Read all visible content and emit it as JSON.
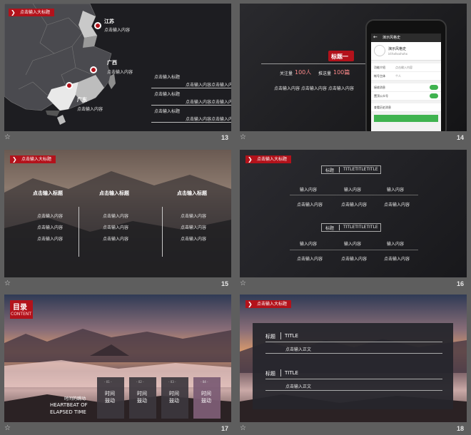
{
  "slides": [
    {
      "number": "13",
      "tag": "点击输入大标题",
      "regions": [
        {
          "name": "江苏",
          "text": "点击输入内容"
        },
        {
          "name": "广西",
          "text": "点击输入内容"
        },
        {
          "name": "广东",
          "text": "点击输入内容"
        }
      ],
      "list": [
        {
          "title": "点击输入标题",
          "text": "点击输入内容点击输入内容"
        },
        {
          "title": "点击输入标题",
          "text": "点击输入内容点击输入内容"
        },
        {
          "title": "点击输入标题",
          "text": "点击输入内容点击输入内容"
        }
      ]
    },
    {
      "number": "14",
      "badge": "标题一",
      "stat1_label": "关注量",
      "stat1_value": "100人",
      "stat2_label": "推送量",
      "stat2_value": "100篇",
      "caption": "点击输入内容 点击输入内容 点击输入内容",
      "phone": {
        "header": "演示风格史",
        "profile_name": "演示风格史",
        "profile_sub": "id:hxhxxhxhx",
        "rows": [
          {
            "label": "功能介绍",
            "value": "点击输入内容"
          },
          {
            "label": "帐号主体",
            "value": "个人"
          },
          {
            "label": "接收消息",
            "value": ""
          },
          {
            "label": "置顶公众号",
            "value": ""
          },
          {
            "label": "查看历史消息",
            "value": ""
          }
        ]
      }
    },
    {
      "number": "15",
      "tag": "点击输入大标题",
      "columns": [
        {
          "title": "点击输入标题",
          "items": [
            "点击输入内容",
            "点击输入内容",
            "点击输入内容"
          ]
        },
        {
          "title": "点击输入标题",
          "items": [
            "点击输入内容",
            "点击输入内容",
            "点击输入内容"
          ]
        },
        {
          "title": "点击输入标题",
          "items": [
            "点击输入内容",
            "点击输入内容",
            "点击输入内容"
          ]
        }
      ]
    },
    {
      "number": "16",
      "tag": "点击输入大标题",
      "blocks": [
        {
          "label": "标题",
          "title": "TITLETITLETITLE",
          "row1": [
            "输入内容",
            "输入内容",
            "输入内容"
          ],
          "row2": [
            "点击输入内容",
            "点击输入内容",
            "点击输入内容"
          ]
        },
        {
          "label": "标题",
          "title": "TITLETITLETITLE",
          "row1": [
            "输入内容",
            "输入内容",
            "输入内容"
          ],
          "row2": [
            "点击输入内容",
            "点击输入内容",
            "点击输入内容"
          ]
        }
      ]
    },
    {
      "number": "17",
      "heading": "目录",
      "heading_en": "CONTENT",
      "subtitle_cn": "时间的跳动",
      "subtitle_en1": "HEARTBEAT OF",
      "subtitle_en2": "ELAPSED TIME",
      "cards": [
        {
          "num": "- 01 -",
          "line1": "时间",
          "line2": "鼓动"
        },
        {
          "num": "- 02 -",
          "line1": "时间",
          "line2": "鼓动"
        },
        {
          "num": "- 03 -",
          "line1": "时间",
          "line2": "鼓动"
        },
        {
          "num": "- 04 -",
          "line1": "时间",
          "line2": "鼓动"
        }
      ]
    },
    {
      "number": "18",
      "tag": "点击输入大标题",
      "items": [
        {
          "label": "标题",
          "title": "TITLE",
          "body": "点击输入正文"
        },
        {
          "label": "标题",
          "title": "TITLE",
          "body": "点击输入正文"
        }
      ]
    }
  ],
  "colors": {
    "accent": "#b3121b",
    "background": "#5e5e5e",
    "green": "#3fb34f",
    "card_highlight": "#7c5d75"
  }
}
